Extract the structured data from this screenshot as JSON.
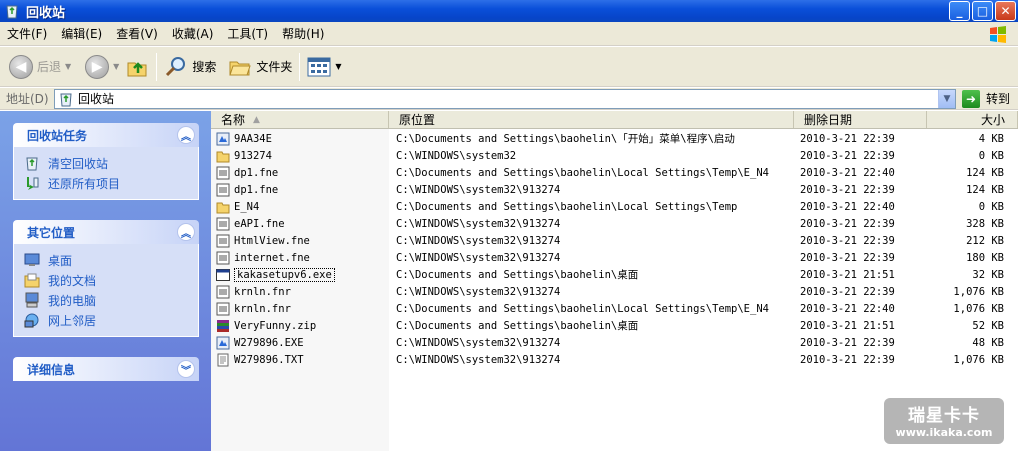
{
  "window": {
    "title": "回收站"
  },
  "menu": [
    "文件(F)",
    "编辑(E)",
    "查看(V)",
    "收藏(A)",
    "工具(T)",
    "帮助(H)"
  ],
  "toolbar": {
    "back": "后退",
    "search": "搜索",
    "folders": "文件夹"
  },
  "address": {
    "label": "地址(D)",
    "value": "回收站",
    "go": "转到"
  },
  "tasks_panel": {
    "title": "回收站任务",
    "items": [
      {
        "label": "清空回收站",
        "icon": "empty-recycle-bin-icon"
      },
      {
        "label": "还原所有项目",
        "icon": "restore-icon"
      }
    ]
  },
  "places_panel": {
    "title": "其它位置",
    "items": [
      {
        "label": "桌面",
        "icon": "desktop-icon"
      },
      {
        "label": "我的文档",
        "icon": "my-documents-icon"
      },
      {
        "label": "我的电脑",
        "icon": "my-computer-icon"
      },
      {
        "label": "网上邻居",
        "icon": "network-places-icon"
      }
    ]
  },
  "details_panel": {
    "title": "详细信息"
  },
  "columns": {
    "name": "名称",
    "original_location": "原位置",
    "date_deleted": "删除日期",
    "size": "大小"
  },
  "files": [
    {
      "name": "9AA34E",
      "location": "C:\\Documents and Settings\\baohelin\\「开始」菜单\\程序\\启动",
      "date": "2010-3-21 22:39",
      "size": "4 KB",
      "icon": "exe"
    },
    {
      "name": "913274",
      "location": "C:\\WINDOWS\\system32",
      "date": "2010-3-21 22:39",
      "size": "0 KB",
      "icon": "folder"
    },
    {
      "name": "dp1.fne",
      "location": "C:\\Documents and Settings\\baohelin\\Local Settings\\Temp\\E_N4",
      "date": "2010-3-21 22:40",
      "size": "124 KB",
      "icon": "file"
    },
    {
      "name": "dp1.fne",
      "location": "C:\\WINDOWS\\system32\\913274",
      "date": "2010-3-21 22:39",
      "size": "124 KB",
      "icon": "file"
    },
    {
      "name": "E_N4",
      "location": "C:\\Documents and Settings\\baohelin\\Local Settings\\Temp",
      "date": "2010-3-21 22:40",
      "size": "0 KB",
      "icon": "folder"
    },
    {
      "name": "eAPI.fne",
      "location": "C:\\WINDOWS\\system32\\913274",
      "date": "2010-3-21 22:39",
      "size": "328 KB",
      "icon": "file"
    },
    {
      "name": "HtmlView.fne",
      "location": "C:\\WINDOWS\\system32\\913274",
      "date": "2010-3-21 22:39",
      "size": "212 KB",
      "icon": "file"
    },
    {
      "name": "internet.fne",
      "location": "C:\\WINDOWS\\system32\\913274",
      "date": "2010-3-21 22:39",
      "size": "180 KB",
      "icon": "file"
    },
    {
      "name": "kakasetupv6.exe",
      "location": "C:\\Documents and Settings\\baohelin\\桌面",
      "date": "2010-3-21 21:51",
      "size": "32 KB",
      "icon": "window"
    },
    {
      "name": "krnln.fnr",
      "location": "C:\\WINDOWS\\system32\\913274",
      "date": "2010-3-21 22:39",
      "size": "1,076 KB",
      "icon": "file"
    },
    {
      "name": "krnln.fnr",
      "location": "C:\\Documents and Settings\\baohelin\\Local Settings\\Temp\\E_N4",
      "date": "2010-3-21 22:40",
      "size": "1,076 KB",
      "icon": "file"
    },
    {
      "name": "VeryFunny.zip",
      "location": "C:\\Documents and Settings\\baohelin\\桌面",
      "date": "2010-3-21 21:51",
      "size": "52 KB",
      "icon": "zip"
    },
    {
      "name": "W279896.EXE",
      "location": "C:\\WINDOWS\\system32\\913274",
      "date": "2010-3-21 22:39",
      "size": "48 KB",
      "icon": "exe"
    },
    {
      "name": "W279896.TXT",
      "location": "C:\\WINDOWS\\system32\\913274",
      "date": "2010-3-21 22:39",
      "size": "1,076 KB",
      "icon": "txt"
    }
  ],
  "watermark": {
    "line1": "瑞星卡卡",
    "line2": "www.ikaka.com"
  }
}
